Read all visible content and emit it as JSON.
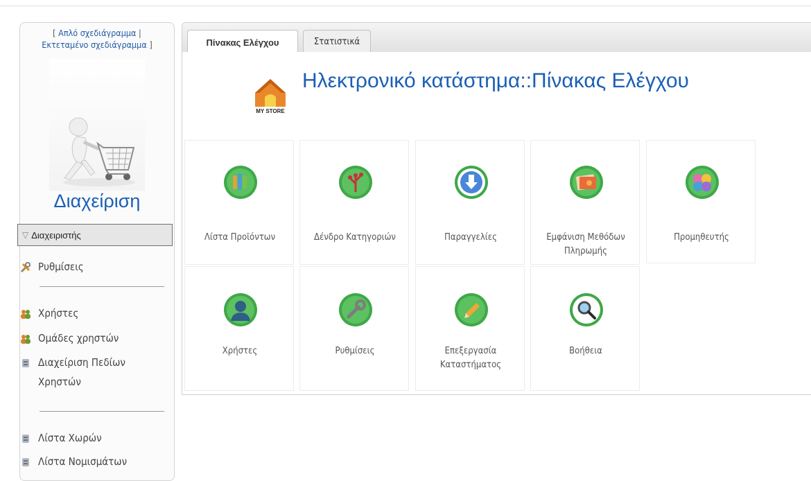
{
  "sidebar": {
    "layout_open": "[",
    "simple_layout": "Απλό σχεδιάγραμμα",
    "separator": "|",
    "extended_layout": "Εκτεταμένο σχεδιάγραμμα",
    "layout_close": "]",
    "title": "Διαχείριση",
    "section_header": "Διαχειριστής",
    "items": [
      {
        "label": "Ρυθμίσεις",
        "icon": "tools-icon"
      },
      {
        "label": "Χρήστες",
        "icon": "users-icon"
      },
      {
        "label": "Ομάδες χρηστών",
        "icon": "user-groups-icon"
      },
      {
        "label": "Διαχείριση Πεδίων Χρηστών",
        "icon": "plugin-icon"
      },
      {
        "label": "Λίστα Χωρών",
        "icon": "plugin-icon"
      },
      {
        "label": "Λίστα Νομισμάτων",
        "icon": "plugin-icon"
      }
    ]
  },
  "tabs": [
    {
      "label": "Πίνακας Ελέγχου",
      "active": true
    },
    {
      "label": "Στατιστικά",
      "active": false
    }
  ],
  "header": {
    "title": "Ηλεκτρονικό κατάστημα::Πίνακας Ελέγχου",
    "logo_text": "MY STORE"
  },
  "tiles": [
    {
      "label": "Λίστα Προϊόντων",
      "icon": "product-list-icon"
    },
    {
      "label": "Δένδρο Κατηγοριών",
      "icon": "category-tree-icon"
    },
    {
      "label": "Παραγγελίες",
      "icon": "orders-download-icon"
    },
    {
      "label": "Εμφάνιση Μεθόδων Πληρωμής",
      "icon": "payment-methods-icon"
    },
    {
      "label": "Προμηθευτής",
      "icon": "vendor-icon"
    },
    {
      "label": "Χρήστες",
      "icon": "user-icon"
    },
    {
      "label": "Ρυθμίσεις",
      "icon": "wrench-icon"
    },
    {
      "label": "Επεξεργασία Καταστήματος",
      "icon": "pencil-icon"
    },
    {
      "label": "Βοήθεια",
      "icon": "magnifier-icon"
    }
  ],
  "colors": {
    "accent": "#1a5fb4",
    "tile_green": "#3fa848"
  }
}
